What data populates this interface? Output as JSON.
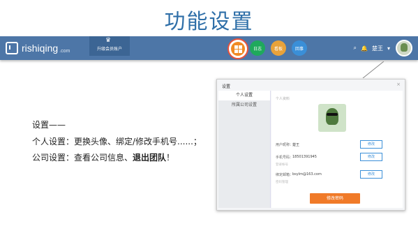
{
  "slide": {
    "title": "功能设置",
    "desc": {
      "heading": "设置——",
      "line1": "个人设置：更换头像、绑定/修改手机号......；",
      "line2_prefix": "公司设置：查看公司信息、",
      "line2_bold": "退出团队",
      "line2_suffix": "！"
    }
  },
  "navbar": {
    "logo_text": "rishiqing",
    "logo_suffix": ".com",
    "upgrade_label": "升级会员账户",
    "nav_items": [
      {
        "label": "",
        "icon": "dashboard-grid-icon",
        "active": true,
        "color": "#f08a24"
      },
      {
        "label": "日志",
        "icon": "journal-icon",
        "active": false,
        "color": "#1fa95c"
      },
      {
        "label": "看板",
        "icon": "kanban-icon",
        "active": false,
        "color": "#e8a23a"
      },
      {
        "label": "回事",
        "icon": "huishi-icon",
        "active": false,
        "color": "#3a8fd8"
      }
    ],
    "user_name": "楚王",
    "bar_color": "#4d76a7"
  },
  "settings_panel": {
    "title": "设置",
    "close": "×",
    "sidebar": [
      "个人设置",
      "所属公司设置"
    ],
    "section_label": "个人资料",
    "fields": [
      {
        "label": "用户昵称：",
        "value": "楚王",
        "button": "修改"
      },
      {
        "label": "手机号码：",
        "value": "18501391945",
        "button": "修改",
        "sub": "登录帐号"
      },
      {
        "label": "绑定邮箱：",
        "value": "bsylm@163.com",
        "button": "修改",
        "sub": "密码管理"
      }
    ],
    "save_label": "修改密码",
    "accent": "#f07a28"
  }
}
